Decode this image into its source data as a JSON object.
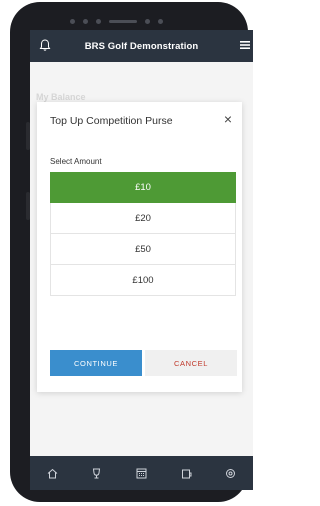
{
  "appbar": {
    "title": "BRS Golf Demonstration"
  },
  "background": {
    "label": "My Balance"
  },
  "modal": {
    "title": "Top Up Competition Purse",
    "close_label": "×",
    "select_label": "Select Amount",
    "amounts": [
      "£10",
      "£20",
      "£50",
      "£100"
    ],
    "selected_index": 0,
    "continue_label": "CONTINUE",
    "cancel_label": "CANCEL"
  },
  "tabbar": {
    "icons": [
      "home-icon",
      "trophy-icon",
      "calendar-icon",
      "wallet-icon",
      "settings-icon"
    ]
  },
  "colors": {
    "appbar": "#2b3440",
    "selected_amount": "#4e9a35",
    "continue": "#3a8ecd",
    "cancel_text": "#c0392b"
  }
}
